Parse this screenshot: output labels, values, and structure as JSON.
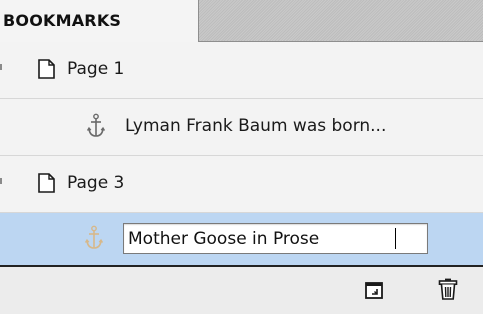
{
  "tab": {
    "label": "BOOKMARKS"
  },
  "bookmarks": [
    {
      "type": "page",
      "label": "Page 1",
      "icon": "page-icon"
    },
    {
      "type": "anchor",
      "label": "Lyman Frank Baum was born...",
      "icon": "anchor-icon"
    },
    {
      "type": "page",
      "label": "Page 3",
      "icon": "page-icon"
    },
    {
      "type": "anchor",
      "label": "Mother Goose in Prose",
      "icon": "anchor-icon",
      "selected": true,
      "editing": true
    }
  ],
  "toolbar": {
    "new_icon": "new-bookmark-icon",
    "delete_icon": "trash-icon"
  },
  "colors": {
    "selection": "#bcd6f2",
    "anchor": "#6a6a6a",
    "anchor_selected": "#d7b88a"
  }
}
